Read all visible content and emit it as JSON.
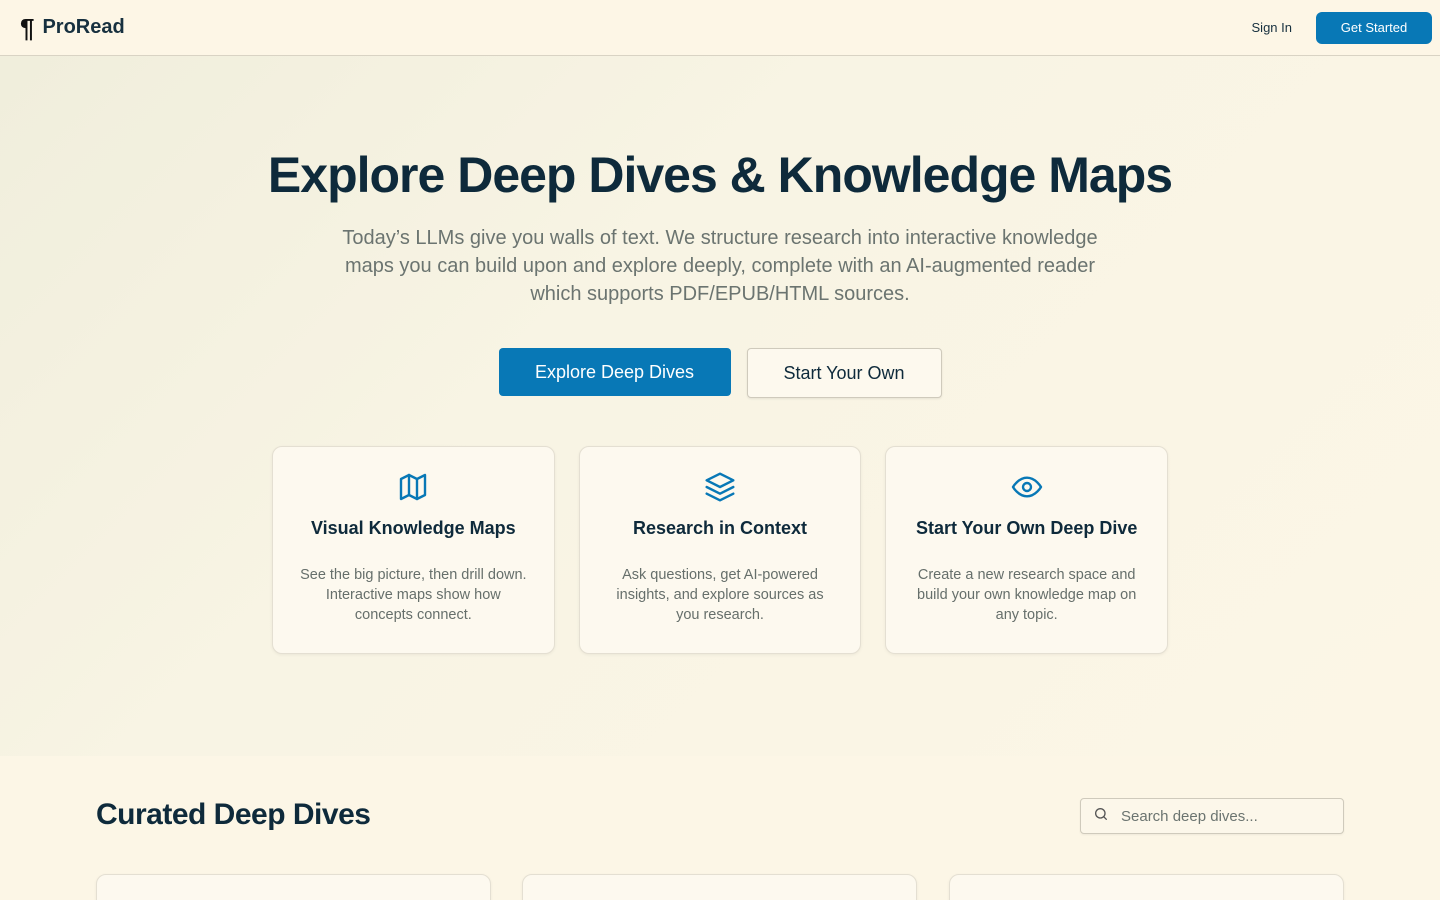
{
  "header": {
    "brand_mark": "¶",
    "brand_name": "ProRead",
    "sign_in_label": "Sign In",
    "get_started_label": "Get Started"
  },
  "hero": {
    "title": "Explore Deep Dives & Knowledge Maps",
    "subtitle": "Today’s LLMs give you walls of text. We structure research into interactive knowledge maps you can build upon and explore deeply, complete with an AI-augmented reader which supports PDF/EPUB/HTML sources.",
    "primary_cta": "Explore Deep Dives",
    "secondary_cta": "Start Your Own"
  },
  "features": [
    {
      "icon": "map-icon",
      "title": "Visual Knowledge Maps",
      "description": "See the big picture, then drill down. Interactive maps show how concepts connect."
    },
    {
      "icon": "layers-icon",
      "title": "Research in Context",
      "description": "Ask questions, get AI-powered insights, and explore sources as you research."
    },
    {
      "icon": "eye-icon",
      "title": "Start Your Own Deep Dive",
      "description": "Create a new research space and build your own knowledge map on any topic."
    }
  ],
  "curated": {
    "title": "Curated Deep Dives",
    "search_placeholder": "Search deep dives..."
  },
  "colors": {
    "accent": "#0878b6",
    "background": "#fcf6e6",
    "heading": "#0e2a3b"
  }
}
